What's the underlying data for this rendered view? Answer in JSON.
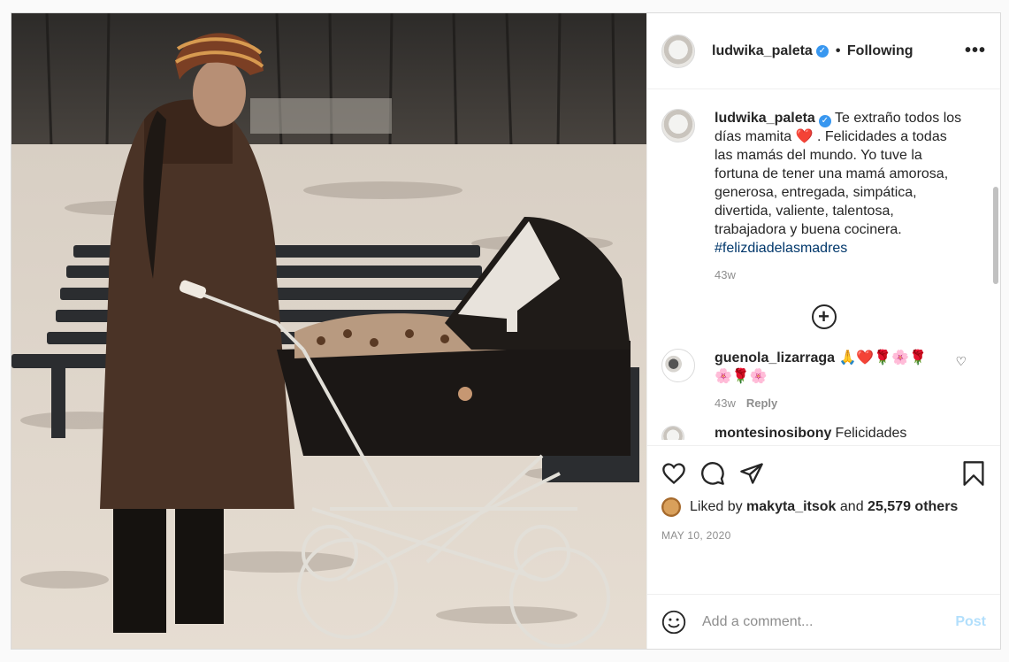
{
  "post": {
    "image_alt_icon": "photo-woman-with-pram-icon",
    "header": {
      "username": "ludwika_paleta",
      "verified_icon": "verified-badge-icon",
      "follow_status": "Following",
      "dot": "•",
      "more_icon": "more-options-icon",
      "more_label": "•••"
    },
    "caption": {
      "username": "ludwika_paleta",
      "text_1": "Te extraño todos los días mamita",
      "heart": "❤️",
      "text_2": ". Felicidades a todas las mamás del mundo. Yo tuve la fortuna de tener una mamá amorosa, generosa, entregada, simpática, divertida, valiente, talentosa, trabajadora y buena cocinera.",
      "hashtag": "#felizdiadelasmadres",
      "age": "43w"
    },
    "load_more_label": "+",
    "comments": [
      {
        "username": "guenola_lizarraga",
        "text": "🙏❤️🌹🌸🌹🌸🌹🌸",
        "age": "43w",
        "reply_label": "Reply",
        "like_icon": "heart-outline-icon",
        "like_glyph": "♡"
      },
      {
        "username": "montesinosibony",
        "text": "Felicidades"
      }
    ],
    "actions": {
      "like_icon": "heart-icon",
      "comment_icon": "comment-icon",
      "share_icon": "share-icon",
      "save_icon": "bookmark-icon"
    },
    "likes": {
      "prefix": "Liked by",
      "user": "makyta_itsok",
      "middle": "and",
      "count": "25,579 others"
    },
    "date": "MAY 10, 2020",
    "add_comment": {
      "placeholder": "Add a comment...",
      "post_label": "Post",
      "emoji_icon": "emoji-icon"
    }
  }
}
